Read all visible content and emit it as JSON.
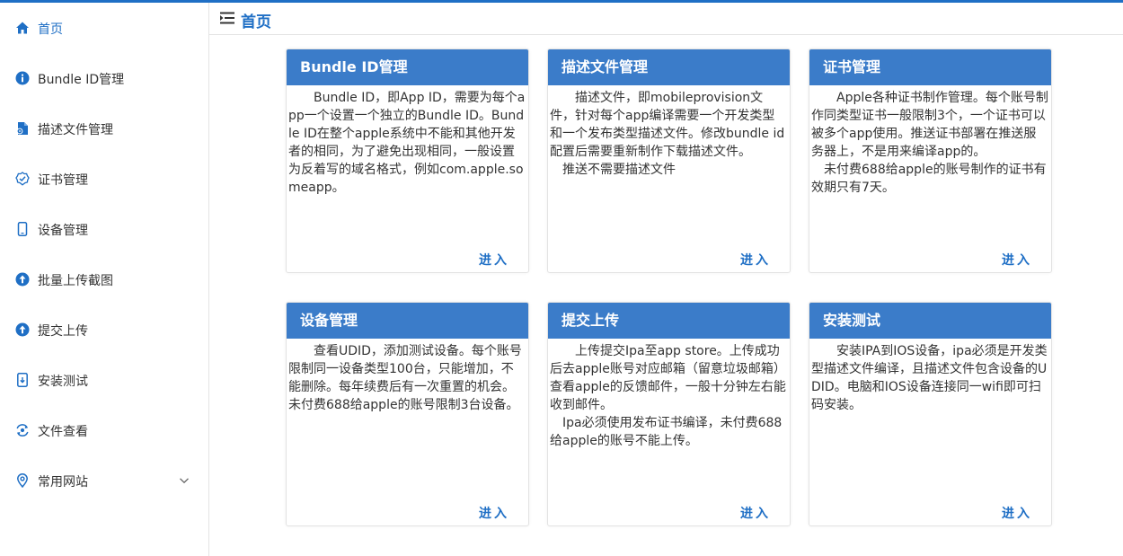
{
  "header": {
    "title": "首页"
  },
  "sidebar": {
    "items": [
      {
        "label": "首页"
      },
      {
        "label": "Bundle ID管理"
      },
      {
        "label": "描述文件管理"
      },
      {
        "label": "证书管理"
      },
      {
        "label": "设备管理"
      },
      {
        "label": "批量上传截图"
      },
      {
        "label": "提交上传"
      },
      {
        "label": "安装测试"
      },
      {
        "label": "文件查看"
      },
      {
        "label": "常用网站"
      }
    ]
  },
  "cards": [
    {
      "title": "Bundle ID管理",
      "paragraphs": [
        "Bundle ID，即App ID，需要为每个app一个设置一个独立的Bundle ID。Bundle ID在整个apple系统中不能和其他开发者的相同，为了避免出现相同，一般设置为反着写的域名格式，例如com.apple.someapp。"
      ],
      "link": "进入"
    },
    {
      "title": "描述文件管理",
      "paragraphs": [
        "描述文件，即mobileprovision文件，针对每个app编译需要一个开发类型和一个发布类型描述文件。修改bundle id配置后需要重新制作下载描述文件。",
        "推送不需要描述文件"
      ],
      "link": "进入"
    },
    {
      "title": "证书管理",
      "paragraphs": [
        "Apple各种证书制作管理。每个账号制作同类型证书一般限制3个，一个证书可以被多个app使用。推送证书部署在推送服务器上，不是用来编译app的。",
        "未付费688给apple的账号制作的证书有效期只有7天。"
      ],
      "link": "进入"
    },
    {
      "title": "设备管理",
      "paragraphs": [
        "查看UDID，添加测试设备。每个账号限制同一设备类型100台，只能增加，不能删除。每年续费后有一次重置的机会。未付费688给apple的账号限制3台设备。"
      ],
      "link": "进入"
    },
    {
      "title": "提交上传",
      "paragraphs": [
        "上传提交Ipa至app store。上传成功后去apple账号对应邮箱（留意垃圾邮箱）查看apple的反馈邮件，一般十分钟左右能收到邮件。",
        "Ipa必须使用发布证书编译，未付费688给apple的账号不能上传。"
      ],
      "link": "进入"
    },
    {
      "title": "安装测试",
      "paragraphs": [
        "安装IPA到IOS设备，ipa必须是开发类型描述文件编译，且描述文件包含设备的UDID。电脑和IOS设备连接同一wifi即可扫码安装。"
      ],
      "link": "进入"
    }
  ],
  "colors": {
    "accent": "#1f6fc5",
    "card_header": "#3b7cc9"
  }
}
